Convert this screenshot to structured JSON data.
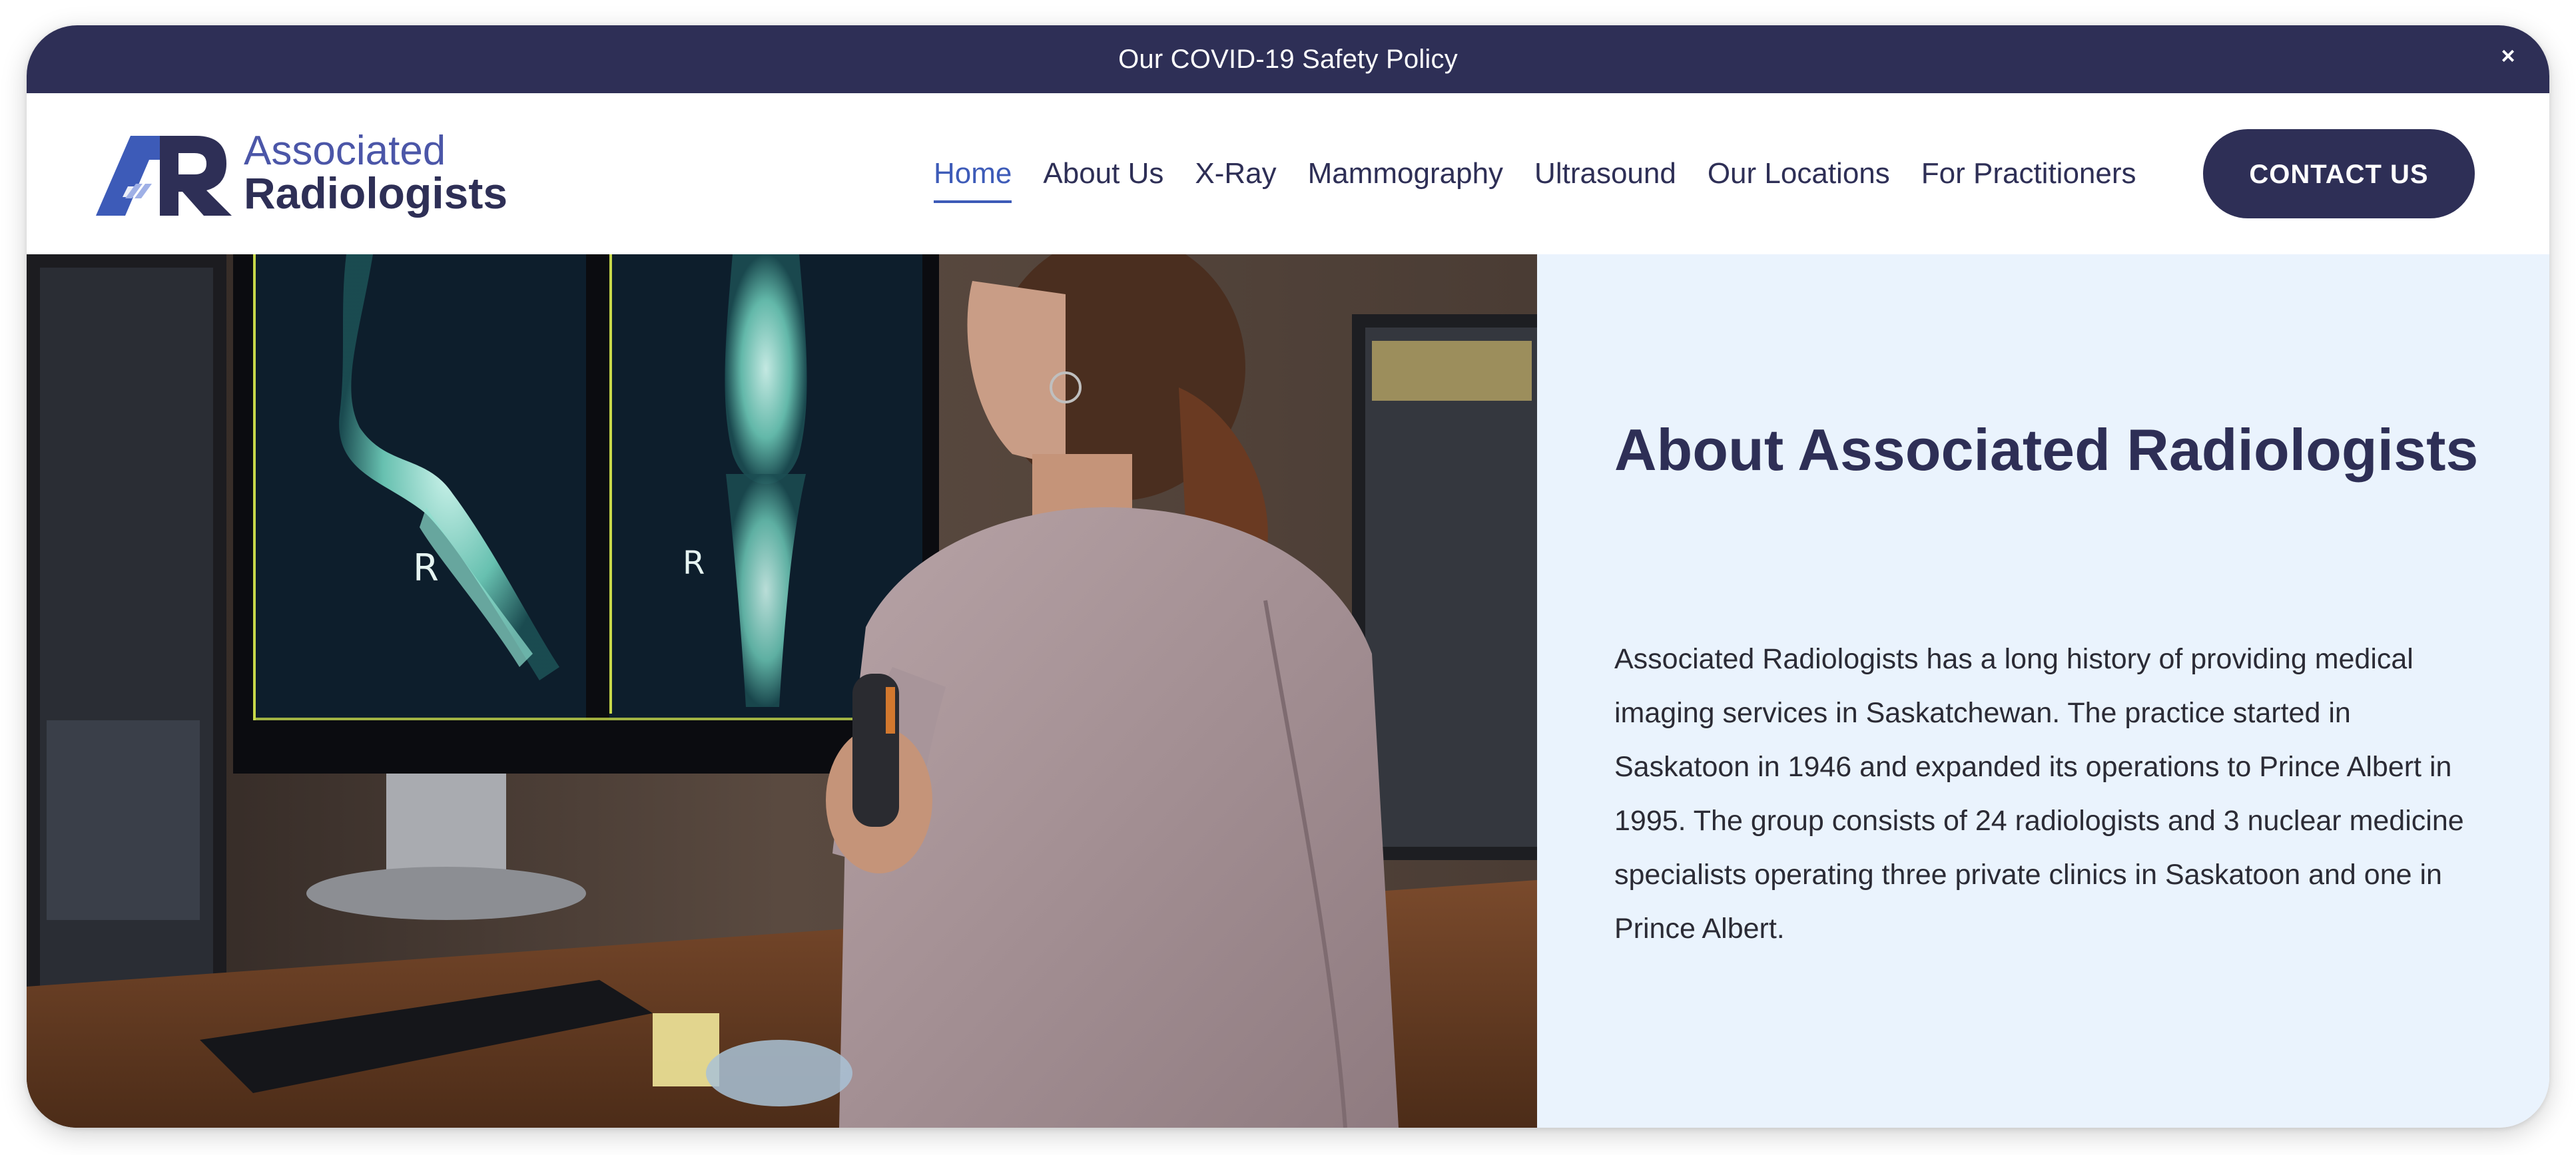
{
  "banner": {
    "text": "Our COVID-19 Safety Policy",
    "close": "×"
  },
  "logo": {
    "line1": "Associated",
    "line2": "Radiologists"
  },
  "nav": {
    "items": [
      {
        "label": "Home",
        "active": true
      },
      {
        "label": "About Us"
      },
      {
        "label": "X-Ray"
      },
      {
        "label": "Mammography"
      },
      {
        "label": "Ultrasound"
      },
      {
        "label": "Our Locations"
      },
      {
        "label": "For Practitioners"
      }
    ],
    "cta": "CONTACT US"
  },
  "about": {
    "title": "About Associated Radiologists",
    "body": "Associated Radiologists has a long history of providing medical imaging services in Saskatchewan. The practice started in Saskatoon in 1946 and expanded its operations to Prince Albert in 1995. The group consists of 24 radiologists and 3 nuclear medicine specialists operating three private clinics in Saskatoon and one in Prince Albert."
  },
  "colors": {
    "navy": "#2e2f56",
    "accent": "#3d5bb8",
    "panel_bg": "#eaf3fd"
  }
}
